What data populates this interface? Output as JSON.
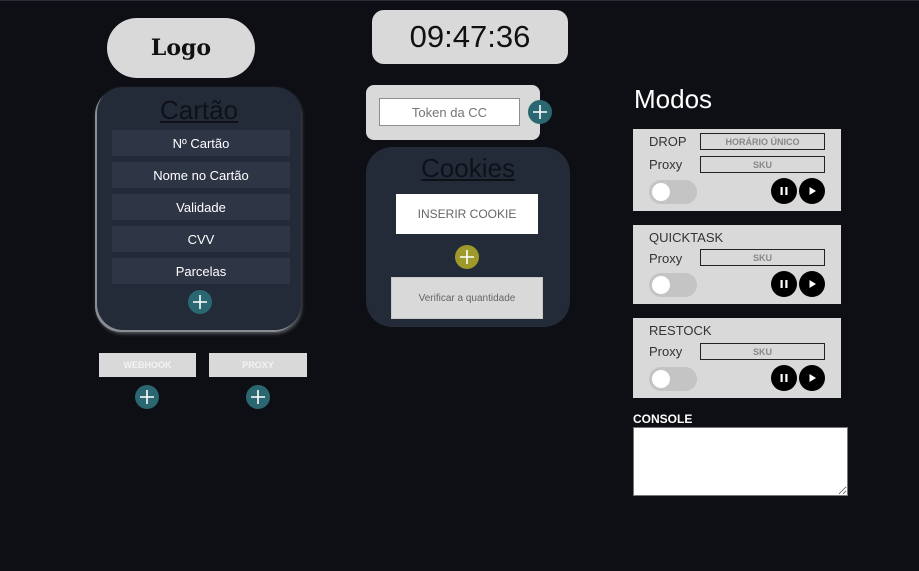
{
  "logo": {
    "text": "Logo"
  },
  "clock": {
    "time": "09:47:36"
  },
  "card": {
    "title": "Cartão",
    "fields": [
      {
        "label": "Nº Cartão"
      },
      {
        "label": "Nome no Cartão"
      },
      {
        "label": "Validade"
      },
      {
        "label": "CVV"
      },
      {
        "label": "Parcelas"
      }
    ]
  },
  "buttons": {
    "webhook": "WEBHOOK",
    "proxy": "PROXY"
  },
  "token": {
    "placeholder": "Token da CC"
  },
  "cookies": {
    "title": "Cookies",
    "input_placeholder": "INSERIR COOKIE",
    "verify_label": "Verificar a quantidade"
  },
  "modos": {
    "title": "Modos",
    "modes": [
      {
        "name": "DROP",
        "field1": "HORÁRIO ÚNICO",
        "proxy_label": "Proxy",
        "proxy_field": "SKU",
        "enabled": false
      },
      {
        "name": "QUICKTASK",
        "proxy_label": "Proxy",
        "proxy_field": "SKU",
        "enabled": false
      },
      {
        "name": "RESTOCK",
        "proxy_label": "Proxy",
        "proxy_field": "SKU",
        "enabled": false
      }
    ]
  },
  "console": {
    "label": "CONSOLE"
  },
  "colors": {
    "background": "#0e0f14",
    "panel": "#232a38",
    "plus_teal": "#2a6770",
    "plus_olive": "#9d9a2b",
    "light_gray": "#d9d9d9"
  }
}
